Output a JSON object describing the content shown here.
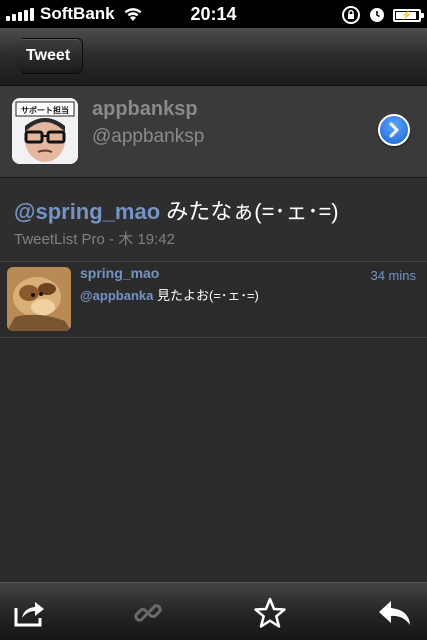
{
  "status_bar": {
    "carrier": "SoftBank",
    "time": "20:14",
    "battery_level": 0.9
  },
  "nav": {
    "back_label": "Tweet"
  },
  "profile": {
    "name": "appbanksp",
    "handle": "@appbanksp",
    "avatar_banner": "サポート担当"
  },
  "tweet": {
    "mention": "@spring_mao",
    "body": " みたなぁ(=･ェ･=)",
    "meta": "TweetList Pro - 木 19:42"
  },
  "reply": {
    "name": "spring_mao",
    "time": "34 mins",
    "mention": "@appbanka",
    "body": " 見たよお(=･ェ･=)"
  },
  "toolbar": {
    "icons": [
      "share-icon",
      "link-icon",
      "star-icon",
      "reply-icon"
    ]
  },
  "colors": {
    "accent": "#7494c6",
    "disclosure": "#1b62d6",
    "muted_text": "#808080"
  }
}
